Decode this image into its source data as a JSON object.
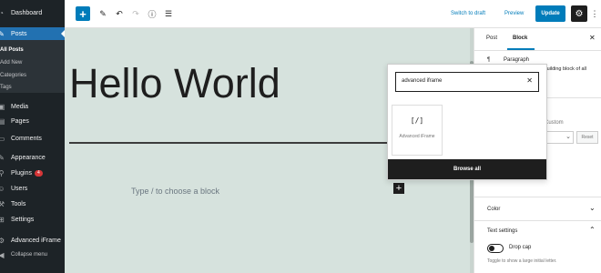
{
  "sidebar": {
    "dashboard": "Dashboard",
    "posts": "Posts",
    "all_posts": "All Posts",
    "add_new": "Add New",
    "categories": "Categories",
    "tags": "Tags",
    "media": "Media",
    "pages": "Pages",
    "comments": "Comments",
    "appearance": "Appearance",
    "plugins": "Plugins",
    "plugins_badge": "4",
    "users": "Users",
    "tools": "Tools",
    "settings": "Settings",
    "advanced_iframe": "Advanced iFrame",
    "collapse": "Collapse menu"
  },
  "toolbar": {
    "add_icon": "+",
    "switch_draft": "Switch to draft",
    "preview": "Preview",
    "update": "Update"
  },
  "editor": {
    "title": "Hello World",
    "placeholder": "Type / to choose a block",
    "add_icon": "+"
  },
  "inserter": {
    "search_value": "advanced iframe",
    "block_icon": "[/]",
    "block_label": "Advanced iFrame",
    "browse_all": "Browse all"
  },
  "settings_panel": {
    "tab_post": "Post",
    "tab_block": "Block",
    "block_name": "Paragraph",
    "block_desc": "...uilding block of all",
    "custom_label": "Custom",
    "reset_label": "Reset",
    "color_section": "Color",
    "text_settings": "Text settings",
    "drop_cap": "Drop cap",
    "drop_cap_help": "Toggle to show a large initial letter."
  },
  "colors": {
    "accent": "#007cba",
    "sidebar_bg": "#1d2327",
    "sidebar_active": "#2271b1",
    "canvas_bg": "#d6e2dd"
  }
}
